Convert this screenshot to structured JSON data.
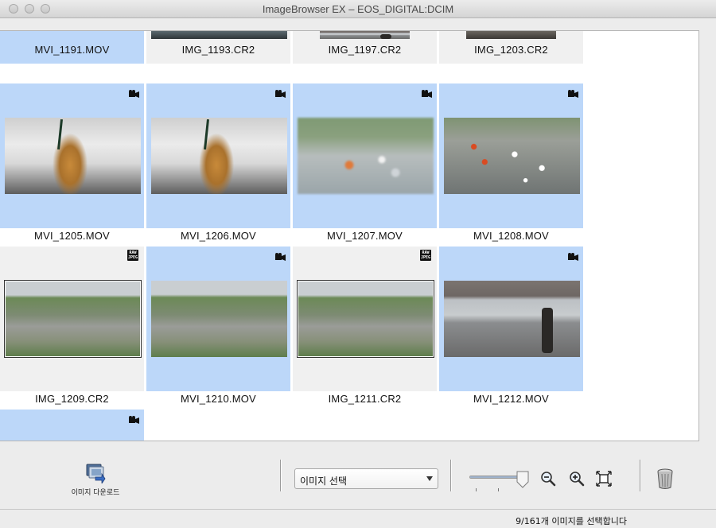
{
  "window": {
    "title": "ImageBrowser EX – EOS_DIGITAL:DCIM"
  },
  "grid": {
    "rows": [
      {
        "cells": [
          {
            "name": "MVI_1191.MOV",
            "selected": true,
            "type": "video",
            "photo": "ph-dark"
          },
          {
            "name": "IMG_1193.CR2",
            "selected": false,
            "type": "raw",
            "photo": "ph-monitor"
          },
          {
            "name": "IMG_1197.CR2",
            "selected": false,
            "type": "raw",
            "photo": "ph-window"
          },
          {
            "name": "IMG_1203.CR2",
            "selected": false,
            "type": "raw",
            "photo": "ph-glasses"
          }
        ]
      },
      {
        "cells": [
          {
            "name": "MVI_1205.MOV",
            "selected": true,
            "type": "video",
            "photo": "ph-cup"
          },
          {
            "name": "MVI_1206.MOV",
            "selected": true,
            "type": "video",
            "photo": "ph-cup"
          },
          {
            "name": "MVI_1207.MOV",
            "selected": true,
            "type": "video",
            "photo": "ph-city-blur"
          },
          {
            "name": "MVI_1208.MOV",
            "selected": true,
            "type": "video",
            "photo": "ph-city-cars"
          }
        ]
      },
      {
        "cells": [
          {
            "name": "IMG_1209.CR2",
            "selected": false,
            "type": "raw",
            "photo": "ph-intersection"
          },
          {
            "name": "MVI_1210.MOV",
            "selected": true,
            "type": "video",
            "photo": "ph-intersection"
          },
          {
            "name": "IMG_1211.CR2",
            "selected": false,
            "type": "raw",
            "photo": "ph-intersection"
          },
          {
            "name": "MVI_1212.MOV",
            "selected": true,
            "type": "video",
            "photo": "ph-window"
          }
        ]
      },
      {
        "cells": [
          {
            "name": "",
            "selected": true,
            "type": "video",
            "photo": "ph-dark"
          }
        ]
      }
    ]
  },
  "raw_badge": {
    "line1": "RAW",
    "line2": "JPEG"
  },
  "toolbar": {
    "download_label": "이미지 다운로드",
    "select_value": "이미지 선택",
    "zoom_level": 0.95,
    "icons": {
      "download": "camera-download-icon",
      "zoom_out": "zoom-out-icon",
      "zoom_in": "zoom-in-icon",
      "fit": "fit-to-window-icon",
      "trash": "trash-icon"
    }
  },
  "status": {
    "text": "9/161개 이미지를 선택합니다"
  },
  "colors": {
    "selected": "#bcd7f9",
    "unselected": "#f0f0f0"
  }
}
